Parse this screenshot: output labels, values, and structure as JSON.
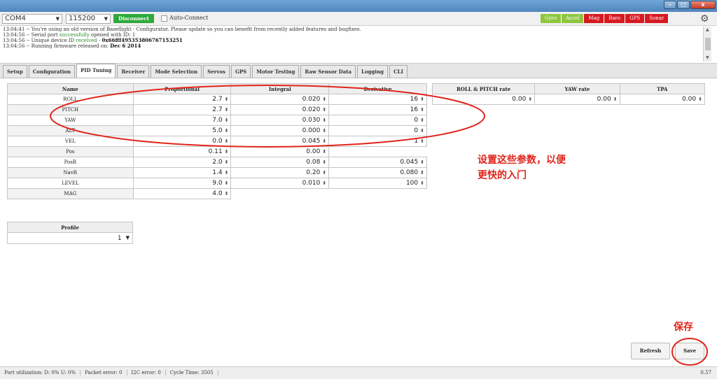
{
  "toolbar": {
    "port": "COM4",
    "baud": "115200",
    "disconnect_label": "Disconnect",
    "auto_connect_label": "Auto-Connect",
    "sensors": [
      {
        "label": "Gyro",
        "color": "#8ec63f"
      },
      {
        "label": "Accel",
        "color": "#8ec63f"
      },
      {
        "label": "Mag",
        "color": "#d71920"
      },
      {
        "label": "Baro",
        "color": "#d71920"
      },
      {
        "label": "GPS",
        "color": "#d71920"
      },
      {
        "label": "Sonar",
        "color": "#d71920"
      }
    ]
  },
  "log": {
    "lines": [
      {
        "pre": "13:04:41 -- You're using an old version of Baseflight - Configurator. Please update so you can benefit from recently added features and bugfixes.",
        "hl": "",
        "post": "",
        "bold": ""
      },
      {
        "pre": "13:04:56 -- Serial port ",
        "hl": "successfully",
        "post": " opened with ID: 1",
        "bold": ""
      },
      {
        "pre": "13:04:56 -- Unique device ID ",
        "hl": "received",
        "post": " - ",
        "bold": "0x66fff495353806767153251"
      },
      {
        "pre": "13:04:56 -- Running firmware released on: ",
        "hl": "",
        "post": "",
        "bold": "Dec 6 2014"
      }
    ]
  },
  "tabs": [
    "Setup",
    "Configuration",
    "PID Tuning",
    "Receiver",
    "Mode Selection",
    "Servos",
    "GPS",
    "Motor Testing",
    "Raw Sensor Data",
    "Logging",
    "CLI"
  ],
  "active_tab": "PID Tuning",
  "pid_table": {
    "headers": [
      "Name",
      "Proportional",
      "Integral",
      "Derivative"
    ],
    "rows": [
      {
        "name": "ROLL",
        "p": "2.7",
        "i": "0.020",
        "d": "16"
      },
      {
        "name": "PITCH",
        "p": "2.7",
        "i": "0.020",
        "d": "16"
      },
      {
        "name": "YAW",
        "p": "7.0",
        "i": "0.030",
        "d": "0"
      },
      {
        "name": "ALT",
        "p": "5.0",
        "i": "0.000",
        "d": "0"
      },
      {
        "name": "VEL",
        "p": "0.0",
        "i": "0.045",
        "d": "1"
      },
      {
        "name": "Pos",
        "p": "0.11",
        "i": "0.00",
        "d": ""
      },
      {
        "name": "PosR",
        "p": "2.0",
        "i": "0.08",
        "d": "0.045"
      },
      {
        "name": "NavR",
        "p": "1.4",
        "i": "0.20",
        "d": "0.080"
      },
      {
        "name": "LEVEL",
        "p": "9.0",
        "i": "0.010",
        "d": "100"
      },
      {
        "name": "MAG",
        "p": "4.0",
        "i": "",
        "d": ""
      }
    ]
  },
  "rate_table": {
    "headers": [
      "ROLL & PITCH rate",
      "YAW rate",
      "TPA"
    ],
    "values": [
      "0.00",
      "0.00",
      "0.00"
    ]
  },
  "profile": {
    "label": "Profile",
    "value": "1"
  },
  "buttons": {
    "refresh": "Refresh",
    "save": "Save"
  },
  "annotations": {
    "line1": "设置这些参数，以便",
    "line2": "更快的入门",
    "save_note": "保存",
    "color": "#e0251b"
  },
  "footer": {
    "port_util": "Port utilization: D: 0% U: 0%",
    "packet_error": "Packet error: 0",
    "i2c_error": "I2C error: 0",
    "cycle_time": "Cycle Time: 3505",
    "version": "0.57"
  }
}
